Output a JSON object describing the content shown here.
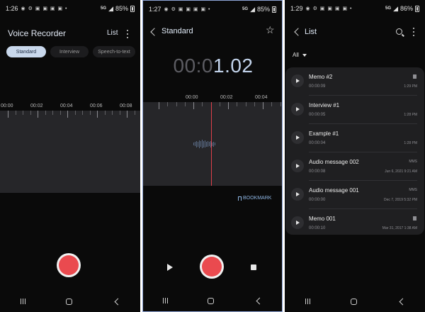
{
  "phone1": {
    "status": {
      "time": "1:26",
      "icons": "◉ ⚙ ▣ ▣ ▣ ▣ •",
      "network": "5G",
      "battery": "85%"
    },
    "app_title": "Voice Recorder",
    "list_label": "List",
    "modes": [
      "Standard",
      "Interview",
      "Speech-to-text"
    ],
    "active_mode": "Standard",
    "timeline": [
      "00:00",
      "00:02",
      "00:04",
      "00:06",
      "00:08"
    ]
  },
  "phone2": {
    "status": {
      "time": "1:27",
      "icons": "◉ ⚙ ▣ ▣ ▣ ▣ •",
      "network": "5G",
      "battery": "85%"
    },
    "title": "Standard",
    "timer_dim": "00:0",
    "timer_lit": "1.02",
    "timeline": [
      "00:00",
      "00:02",
      "00:04"
    ],
    "bookmark_label": "BOOKMARK"
  },
  "phone3": {
    "status": {
      "time": "1:29",
      "icons": "◉ ⚙ ▣ ▣ ▣ ▣ •",
      "network": "5G",
      "battery": "86%"
    },
    "title": "List",
    "filter": "All",
    "recordings": [
      {
        "name": "Memo #2",
        "duration": "00:00:09",
        "meta": "",
        "date": "1:29 PM",
        "icon": "document-icon"
      },
      {
        "name": "Interview #1",
        "duration": "00:00:05",
        "meta": "",
        "date": "1:28 PM",
        "icon": ""
      },
      {
        "name": "Example #1",
        "duration": "00:00:04",
        "meta": "",
        "date": "1:28 PM",
        "icon": ""
      },
      {
        "name": "Audio message 002",
        "duration": "00:00:08",
        "meta": "MMS",
        "date": "Jun 6, 2021 9:21 AM",
        "icon": ""
      },
      {
        "name": "Audio message 001",
        "duration": "00:00:00",
        "meta": "MMS",
        "date": "Dec 7, 2019 5:32 PM",
        "icon": ""
      },
      {
        "name": "Memo 001",
        "duration": "00:00:10",
        "meta": "",
        "date": "Mar 31, 2017 1:38 AM",
        "icon": "document-icon"
      }
    ]
  },
  "colors": {
    "record": "#ea4a4f",
    "accent": "#8eb5e2",
    "playhead": "#e0404a"
  }
}
